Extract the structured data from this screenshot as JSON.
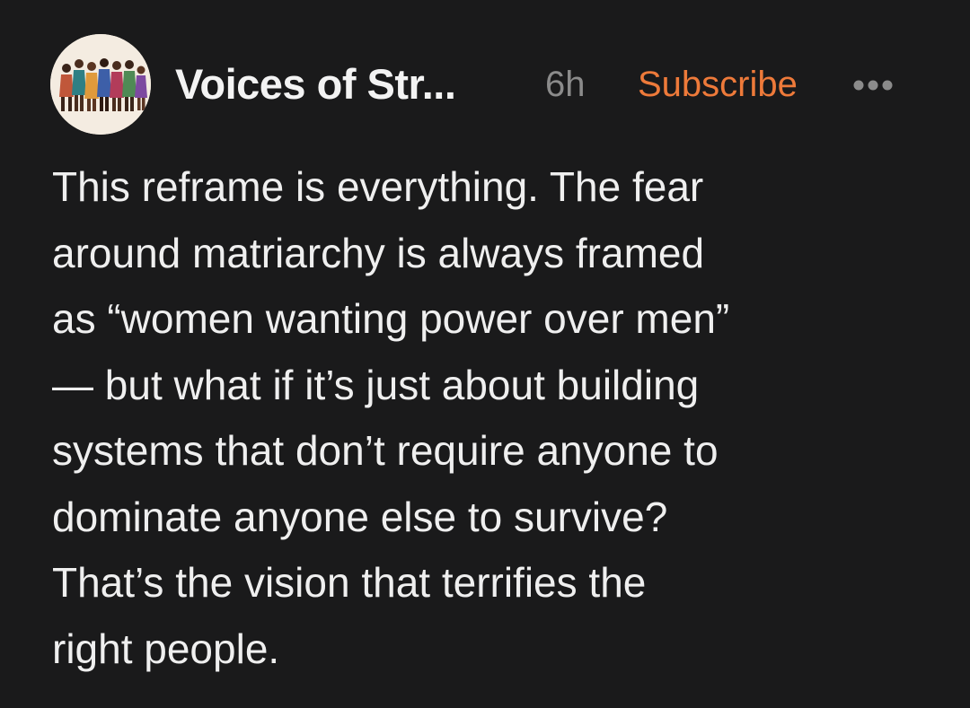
{
  "post": {
    "author": "Voices of Str...",
    "time": "6h",
    "subscribe_label": "Subscribe",
    "more_icon": "ellipsis-icon",
    "avatar_icon": "group-of-women-illustration",
    "accent_color": "#ee7a3a",
    "body_lines": [
      "This reframe is everything. The fear",
      "around matriarchy is always framed",
      "as “women wanting power over men”",
      "— but what if it’s just about building",
      "systems that don’t require anyone to",
      "dominate anyone else to survive?",
      "That’s the vision that terrifies the",
      "right people."
    ]
  }
}
